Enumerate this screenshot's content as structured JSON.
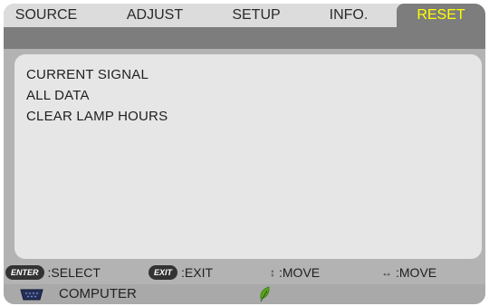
{
  "tabs": [
    {
      "label": "SOURCE",
      "active": false
    },
    {
      "label": "ADJUST",
      "active": false
    },
    {
      "label": "SETUP",
      "active": false
    },
    {
      "label": "INFO.",
      "active": false
    },
    {
      "label": "RESET",
      "active": true
    }
  ],
  "menu": {
    "items": [
      "CURRENT SIGNAL",
      "ALL DATA",
      "CLEAR LAMP HOURS"
    ]
  },
  "footer": {
    "enter_key": "ENTER",
    "enter_action": ":SELECT",
    "exit_key": "EXIT",
    "exit_action": ":EXIT",
    "updown_glyph": "↕",
    "updown_action": ":MOVE",
    "leftright_glyph": "↔",
    "leftright_action": ":MOVE"
  },
  "status": {
    "source": "COMPUTER",
    "source_icon": "computer-port-icon",
    "eco_icon": "leaf-icon"
  },
  "colors": {
    "active_tab_text": "#ffff00",
    "active_tab_bg": "#7d7d7d",
    "eco_leaf": "#5aa21e"
  }
}
